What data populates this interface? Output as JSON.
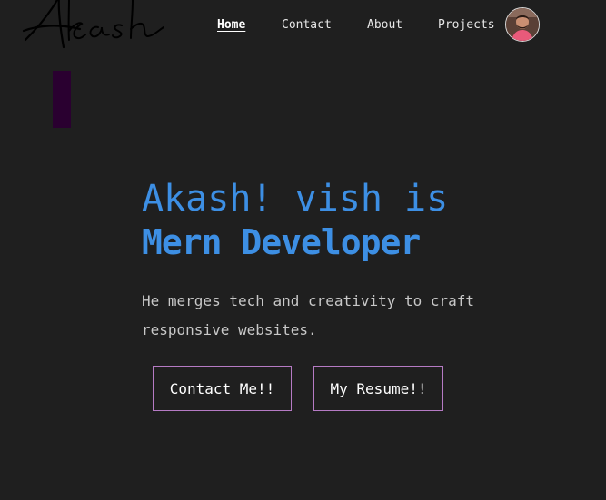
{
  "brand": {
    "logo_text": "Akash",
    "logo_icon": "signature-logo"
  },
  "nav": {
    "items": [
      {
        "label": "Home",
        "active": true
      },
      {
        "label": "Contact",
        "active": false
      },
      {
        "label": "About",
        "active": false
      },
      {
        "label": "Projects",
        "active": false
      }
    ],
    "avatar_icon": "profile-avatar"
  },
  "hero": {
    "title_line1": "Akash! vish is",
    "title_line2": "Mern Developer",
    "subtitle": "He merges tech and creativity to craft responsive websites.",
    "buttons": {
      "contact_label": "Contact Me!!",
      "resume_label": "My Resume!!"
    }
  },
  "colors": {
    "background": "#1f1f1f",
    "accent_blue": "#3d8fe4",
    "button_border": "#b57ac4",
    "accent_bar": "#2a0030"
  }
}
